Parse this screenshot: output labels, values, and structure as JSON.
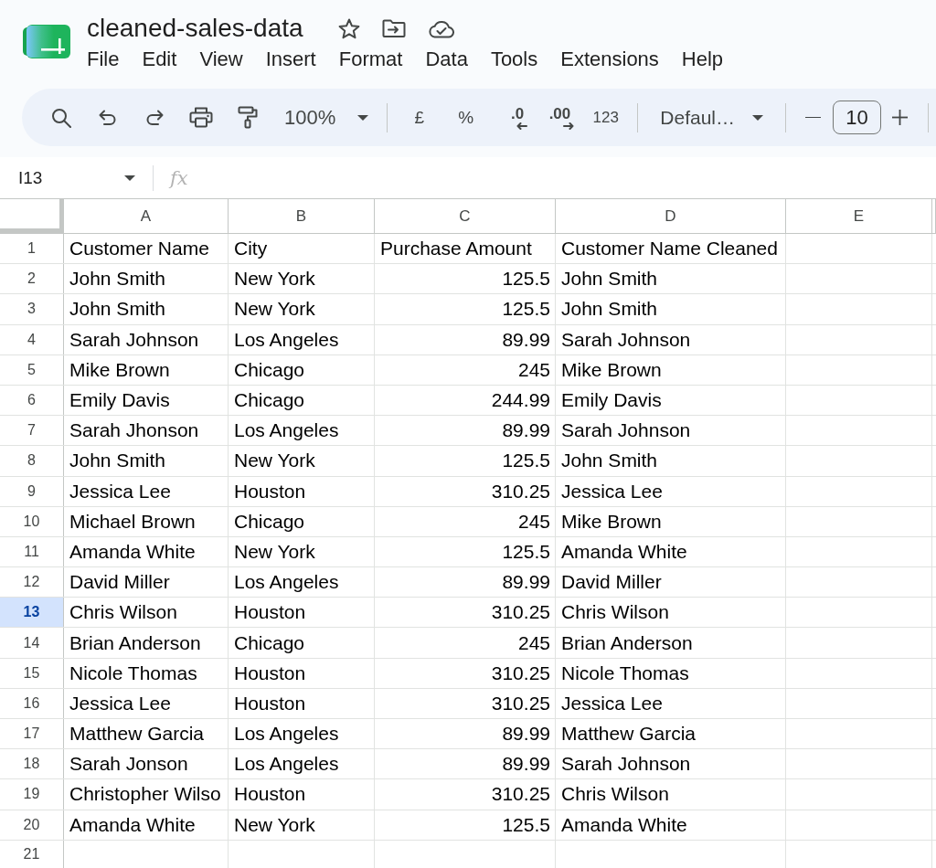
{
  "document": {
    "title": "cleaned-sales-data"
  },
  "menu": [
    "File",
    "Edit",
    "View",
    "Insert",
    "Format",
    "Data",
    "Tools",
    "Extensions",
    "Help"
  ],
  "toolbar": {
    "zoom": "100%",
    "currency": "£",
    "percent": "%",
    "decrease_decimal": ".0",
    "increase_decimal": ".00",
    "number_format": "123",
    "font": "Defaul…",
    "font_size": "10"
  },
  "formula_bar": {
    "name_box": "I13",
    "function_label": "fx"
  },
  "sheet": {
    "columns": [
      "A",
      "B",
      "C",
      "D",
      "E"
    ],
    "rows": [
      {
        "number": "1",
        "selected": false,
        "cells": [
          {
            "kind": "text",
            "text": "Customer Name"
          },
          {
            "kind": "text",
            "text": "City"
          },
          {
            "kind": "text",
            "text": "Purchase Amount"
          },
          {
            "kind": "text",
            "text": "Customer Name Cleaned"
          }
        ]
      },
      {
        "number": "2",
        "selected": false,
        "cells": [
          {
            "kind": "text",
            "text": "John Smith"
          },
          {
            "kind": "text",
            "text": "New York"
          },
          {
            "kind": "number",
            "text": "125.5"
          },
          {
            "kind": "text",
            "text": "John Smith"
          }
        ]
      },
      {
        "number": "3",
        "selected": false,
        "cells": [
          {
            "kind": "text",
            "text": "John Smith"
          },
          {
            "kind": "text",
            "text": "New York"
          },
          {
            "kind": "number",
            "text": "125.5"
          },
          {
            "kind": "text",
            "text": "John Smith"
          }
        ]
      },
      {
        "number": "4",
        "selected": false,
        "cells": [
          {
            "kind": "text",
            "text": "Sarah Johnson"
          },
          {
            "kind": "text",
            "text": "Los Angeles"
          },
          {
            "kind": "number",
            "text": "89.99"
          },
          {
            "kind": "text",
            "text": "Sarah Johnson"
          }
        ]
      },
      {
        "number": "5",
        "selected": false,
        "cells": [
          {
            "kind": "text",
            "text": "Mike Brown"
          },
          {
            "kind": "text",
            "text": "Chicago"
          },
          {
            "kind": "number",
            "text": "245"
          },
          {
            "kind": "text",
            "text": "Mike Brown"
          }
        ]
      },
      {
        "number": "6",
        "selected": false,
        "cells": [
          {
            "kind": "text",
            "text": "Emily Davis"
          },
          {
            "kind": "text",
            "text": "Chicago"
          },
          {
            "kind": "number",
            "text": "244.99"
          },
          {
            "kind": "text",
            "text": "Emily Davis"
          }
        ]
      },
      {
        "number": "7",
        "selected": false,
        "cells": [
          {
            "kind": "text",
            "text": "Sarah Jhonson"
          },
          {
            "kind": "text",
            "text": "Los Angeles"
          },
          {
            "kind": "number",
            "text": "89.99"
          },
          {
            "kind": "text",
            "text": "Sarah Johnson"
          }
        ]
      },
      {
        "number": "8",
        "selected": false,
        "cells": [
          {
            "kind": "text",
            "text": "John Smith"
          },
          {
            "kind": "text",
            "text": "New York"
          },
          {
            "kind": "number",
            "text": "125.5"
          },
          {
            "kind": "text",
            "text": "John Smith"
          }
        ]
      },
      {
        "number": "9",
        "selected": false,
        "cells": [
          {
            "kind": "text",
            "text": "Jessica Lee"
          },
          {
            "kind": "text",
            "text": "Houston"
          },
          {
            "kind": "number",
            "text": "310.25"
          },
          {
            "kind": "text",
            "text": "Jessica Lee"
          }
        ]
      },
      {
        "number": "10",
        "selected": false,
        "cells": [
          {
            "kind": "text",
            "text": "Michael Brown"
          },
          {
            "kind": "text",
            "text": "Chicago"
          },
          {
            "kind": "number",
            "text": "245"
          },
          {
            "kind": "text",
            "text": "Mike Brown"
          }
        ]
      },
      {
        "number": "11",
        "selected": false,
        "cells": [
          {
            "kind": "text",
            "text": "Amanda White"
          },
          {
            "kind": "text",
            "text": "New York"
          },
          {
            "kind": "number",
            "text": "125.5"
          },
          {
            "kind": "text",
            "text": "Amanda White"
          }
        ]
      },
      {
        "number": "12",
        "selected": false,
        "cells": [
          {
            "kind": "text",
            "text": "David Miller"
          },
          {
            "kind": "text",
            "text": "Los Angeles"
          },
          {
            "kind": "number",
            "text": "89.99"
          },
          {
            "kind": "text",
            "text": "David Miller"
          }
        ]
      },
      {
        "number": "13",
        "selected": true,
        "cells": [
          {
            "kind": "text",
            "text": "Chris Wilson"
          },
          {
            "kind": "text",
            "text": "Houston"
          },
          {
            "kind": "number",
            "text": "310.25"
          },
          {
            "kind": "text",
            "text": "Chris Wilson"
          }
        ]
      },
      {
        "number": "14",
        "selected": false,
        "cells": [
          {
            "kind": "text",
            "text": "Brian Anderson"
          },
          {
            "kind": "text",
            "text": "Chicago"
          },
          {
            "kind": "number",
            "text": "245"
          },
          {
            "kind": "text",
            "text": "Brian Anderson"
          }
        ]
      },
      {
        "number": "15",
        "selected": false,
        "cells": [
          {
            "kind": "text",
            "text": "Nicole Thomas"
          },
          {
            "kind": "text",
            "text": "Houston"
          },
          {
            "kind": "number",
            "text": "310.25"
          },
          {
            "kind": "text",
            "text": "Nicole Thomas"
          }
        ]
      },
      {
        "number": "16",
        "selected": false,
        "cells": [
          {
            "kind": "text",
            "text": "Jessica Lee"
          },
          {
            "kind": "text",
            "text": "Houston"
          },
          {
            "kind": "number",
            "text": "310.25"
          },
          {
            "kind": "text",
            "text": "Jessica Lee"
          }
        ]
      },
      {
        "number": "17",
        "selected": false,
        "cells": [
          {
            "kind": "text",
            "text": "Matthew Garcia"
          },
          {
            "kind": "text",
            "text": "Los Angeles"
          },
          {
            "kind": "number",
            "text": "89.99"
          },
          {
            "kind": "text",
            "text": "Matthew Garcia"
          }
        ]
      },
      {
        "number": "18",
        "selected": false,
        "cells": [
          {
            "kind": "text",
            "text": "Sarah Jonson"
          },
          {
            "kind": "text",
            "text": "Los Angeles"
          },
          {
            "kind": "number",
            "text": "89.99"
          },
          {
            "kind": "text",
            "text": "Sarah Johnson"
          }
        ]
      },
      {
        "number": "19",
        "selected": false,
        "cells": [
          {
            "kind": "text",
            "text": "Christopher Wilso"
          },
          {
            "kind": "text",
            "text": "Houston"
          },
          {
            "kind": "number",
            "text": "310.25"
          },
          {
            "kind": "text",
            "text": "Chris Wilson"
          }
        ]
      },
      {
        "number": "20",
        "selected": false,
        "cells": [
          {
            "kind": "text",
            "text": "Amanda White"
          },
          {
            "kind": "text",
            "text": "New York"
          },
          {
            "kind": "number",
            "text": "125.5"
          },
          {
            "kind": "text",
            "text": "Amanda White"
          }
        ]
      },
      {
        "number": "21",
        "selected": false
      }
    ]
  }
}
